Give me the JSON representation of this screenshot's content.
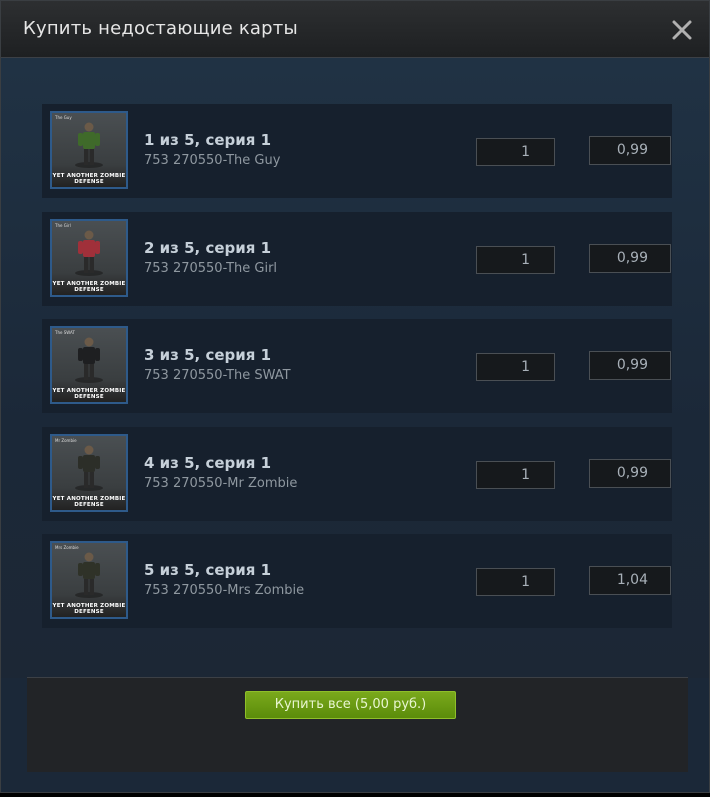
{
  "dialog": {
    "title": "Купить недостающие карты",
    "close_icon": "close-icon"
  },
  "cards": [
    {
      "heading": "1 из 5, серия 1",
      "subtitle": "753 270550-The Guy",
      "quantity": "1",
      "price": "0,99",
      "thumb_label": "The Guy",
      "thumb_logo": "YET ANOTHER ZOMBIE DEFENSE",
      "figure_color": "#3f6a2a"
    },
    {
      "heading": "2 из 5, серия 1",
      "subtitle": "753 270550-The Girl",
      "quantity": "1",
      "price": "0,99",
      "thumb_label": "The Girl",
      "thumb_logo": "YET ANOTHER ZOMBIE DEFENSE",
      "figure_color": "#a0303a"
    },
    {
      "heading": "3 из 5, серия 1",
      "subtitle": "753 270550-The SWAT",
      "quantity": "1",
      "price": "0,99",
      "thumb_label": "The SWAT",
      "thumb_logo": "YET ANOTHER ZOMBIE DEFENSE",
      "figure_color": "#1e1f21"
    },
    {
      "heading": "4 из 5, серия 1",
      "subtitle": "753 270550-Mr Zombie",
      "quantity": "1",
      "price": "0,99",
      "thumb_label": "Mr Zombie",
      "thumb_logo": "YET ANOTHER ZOMBIE DEFENSE",
      "figure_color": "#2c2e28"
    },
    {
      "heading": "5 из 5, серия 1",
      "subtitle": "753 270550-Mrs Zombie",
      "quantity": "1",
      "price": "1,04",
      "thumb_label": "Mrs Zombie",
      "thumb_logo": "YET ANOTHER ZOMBIE DEFENSE",
      "figure_color": "#2f3228"
    }
  ],
  "footer": {
    "buy_all_label": "Купить все (5,00 руб.)"
  },
  "colors": {
    "accent_button": "#6a9c14",
    "background": "#1b2838"
  }
}
